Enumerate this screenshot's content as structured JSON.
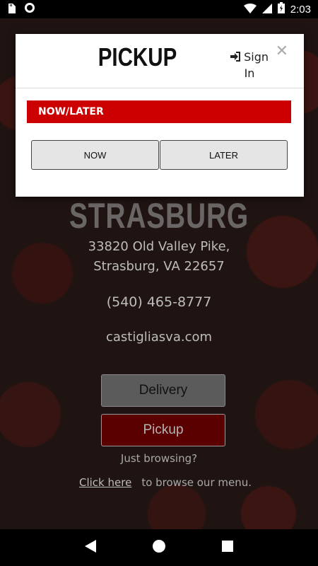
{
  "status_bar": {
    "time": "2:03",
    "icons": [
      "sd-card-icon",
      "sync-icon",
      "wifi-icon",
      "signal-icon",
      "battery-charging-icon"
    ]
  },
  "background": {
    "store_name": "STRASBURG",
    "address_line1": "33820 Old Valley Pike,",
    "address_line2": "Strasburg, VA 22657",
    "phone": "(540) 465-8777",
    "website": "castigliasva.com",
    "delivery_label": "Delivery",
    "pickup_label": "Pickup",
    "browsing_text": "Just browsing?",
    "click_here_label": "Click here",
    "browse_menu_text": "to browse our menu."
  },
  "modal": {
    "title": "PICKUP",
    "signin_label": "Sign In",
    "close_symbol": "✕",
    "section_title": "NOW/LATER",
    "now_label": "NOW",
    "later_label": "LATER"
  },
  "colors": {
    "accent_red": "#cc0000",
    "pickup_dark_red": "#5a0000"
  },
  "nav": {
    "icons": [
      "back-icon",
      "home-icon",
      "recents-icon"
    ]
  }
}
